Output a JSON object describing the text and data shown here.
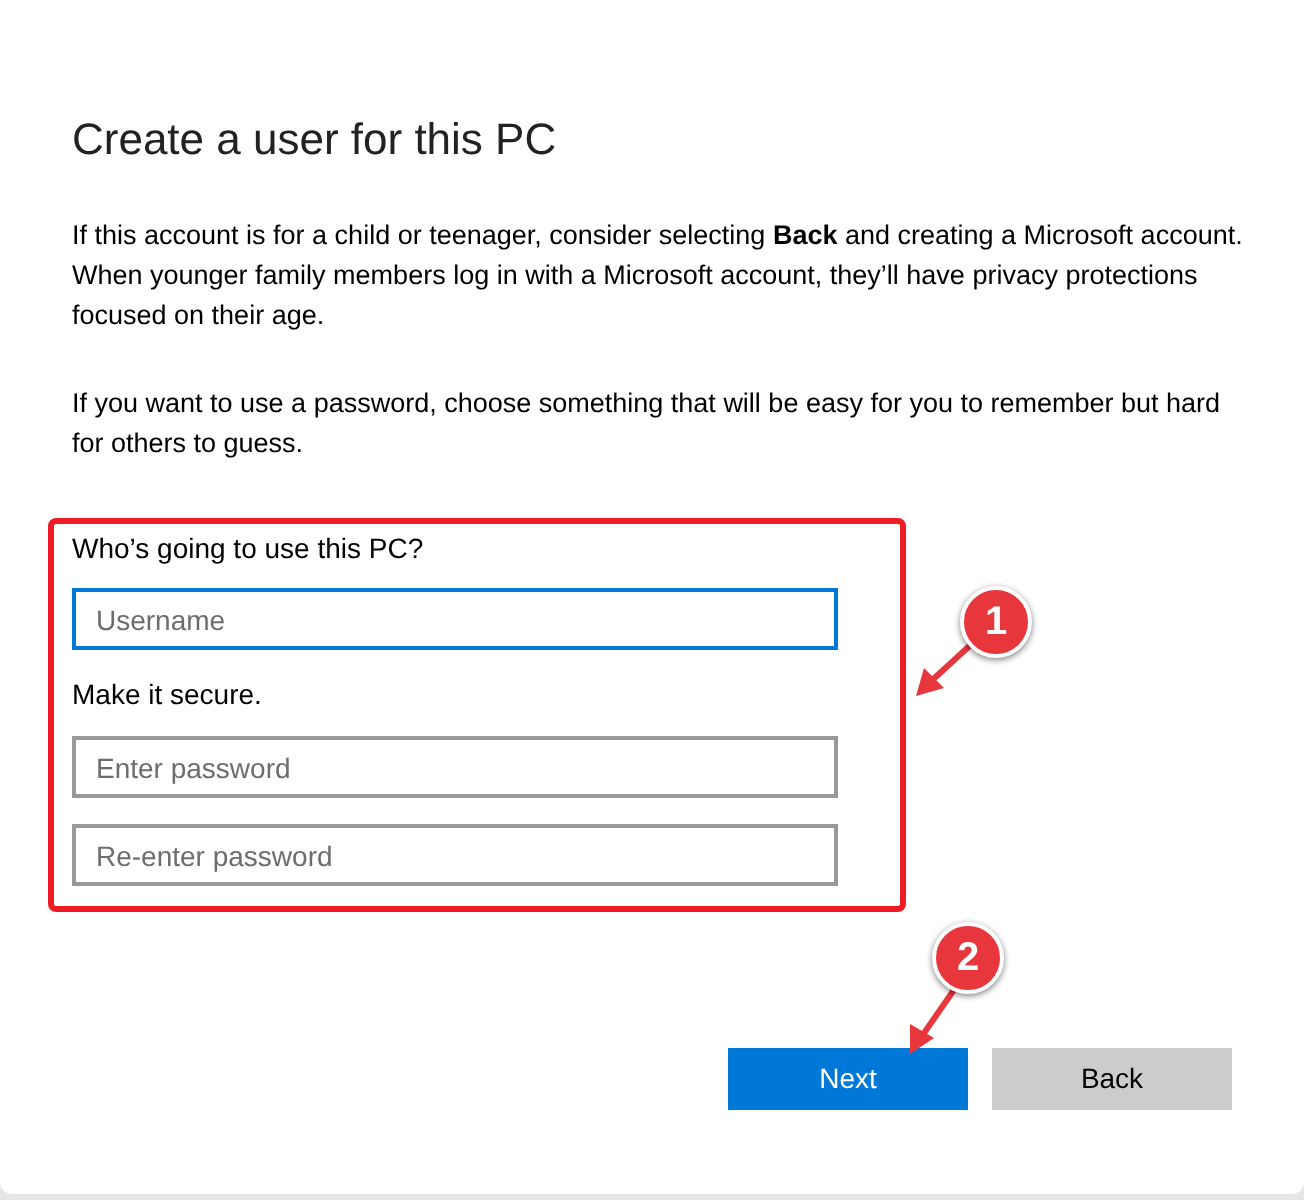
{
  "dialog": {
    "title": "Create a user for this PC",
    "paragraphs": [
      "If this account is for a child or teenager, consider selecting **Back** and creating a Microsoft account. When younger family members log in with a Microsoft account, they’ll have privacy protections focused on their age.",
      "If you want to use a password, choose something that will be easy for you to remember but hard for others to guess."
    ],
    "form": {
      "username_label": "Who’s going to use this PC?",
      "username": {
        "placeholder": "Username",
        "focused": true
      },
      "secure_label": "Make it secure.",
      "passwords": [
        {
          "placeholder": "Enter password",
          "focused": false
        },
        {
          "placeholder": "Re-enter password",
          "focused": false
        }
      ]
    },
    "buttons": [
      {
        "label": "Next",
        "kind": "primary"
      },
      {
        "label": "Back",
        "kind": "secondary"
      }
    ]
  },
  "annotations": [
    {
      "number": "1"
    },
    {
      "number": "2"
    }
  ]
}
